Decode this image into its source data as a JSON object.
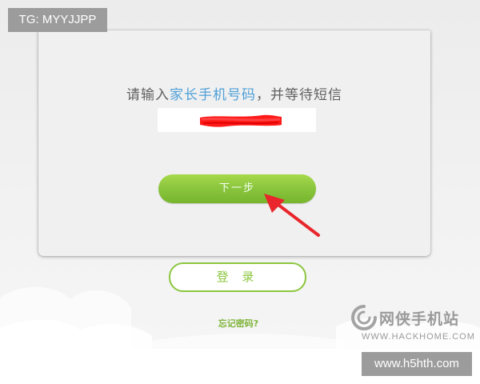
{
  "watermarks": {
    "tg_label": "TG: MYYJJPP",
    "brand_cn": "网侠手机站",
    "brand_en": "WWW.HACKHOME.COM",
    "site_label": "www.h5hth.com"
  },
  "card": {
    "prompt_before": "请输入",
    "prompt_highlight": "家长手机号码",
    "prompt_after": "，并等待短信",
    "phone_field": {
      "placeholder": "",
      "value_redacted": true
    },
    "next_button_label": "下一步"
  },
  "login_button_label": "登 录",
  "forgot_password_label": "忘记密码?",
  "colors": {
    "accent_green": "#8cc63f",
    "highlight_blue": "#4fa0d8",
    "redaction_red": "#ff1a1a",
    "arrow_red": "#e8262b"
  }
}
